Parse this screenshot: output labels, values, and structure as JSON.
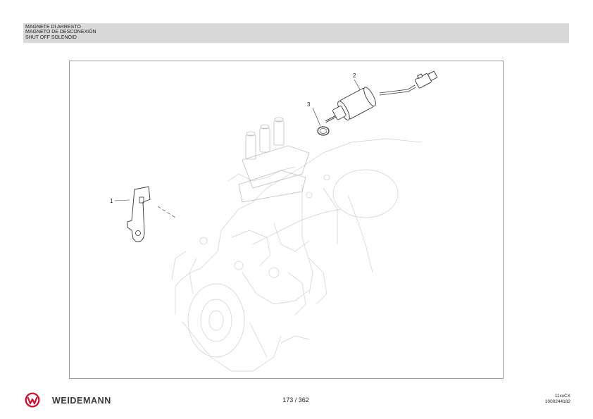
{
  "header": {
    "title_it": "MAGNETE DI ARRESTO",
    "title_es": "MAGNETO DE DESCONEXIÓN",
    "title_en": "SHUT OFF SOLENOID"
  },
  "figure": {
    "callouts": [
      "1",
      "2",
      "3"
    ]
  },
  "footer": {
    "brand": "WEIDEMANN",
    "logo_icon": "weidemann-w-logo-icon",
    "page": "173 / 362",
    "model_code": "11xxCX",
    "doc_number": "1000244182",
    "brand_color": "#c8102e"
  }
}
